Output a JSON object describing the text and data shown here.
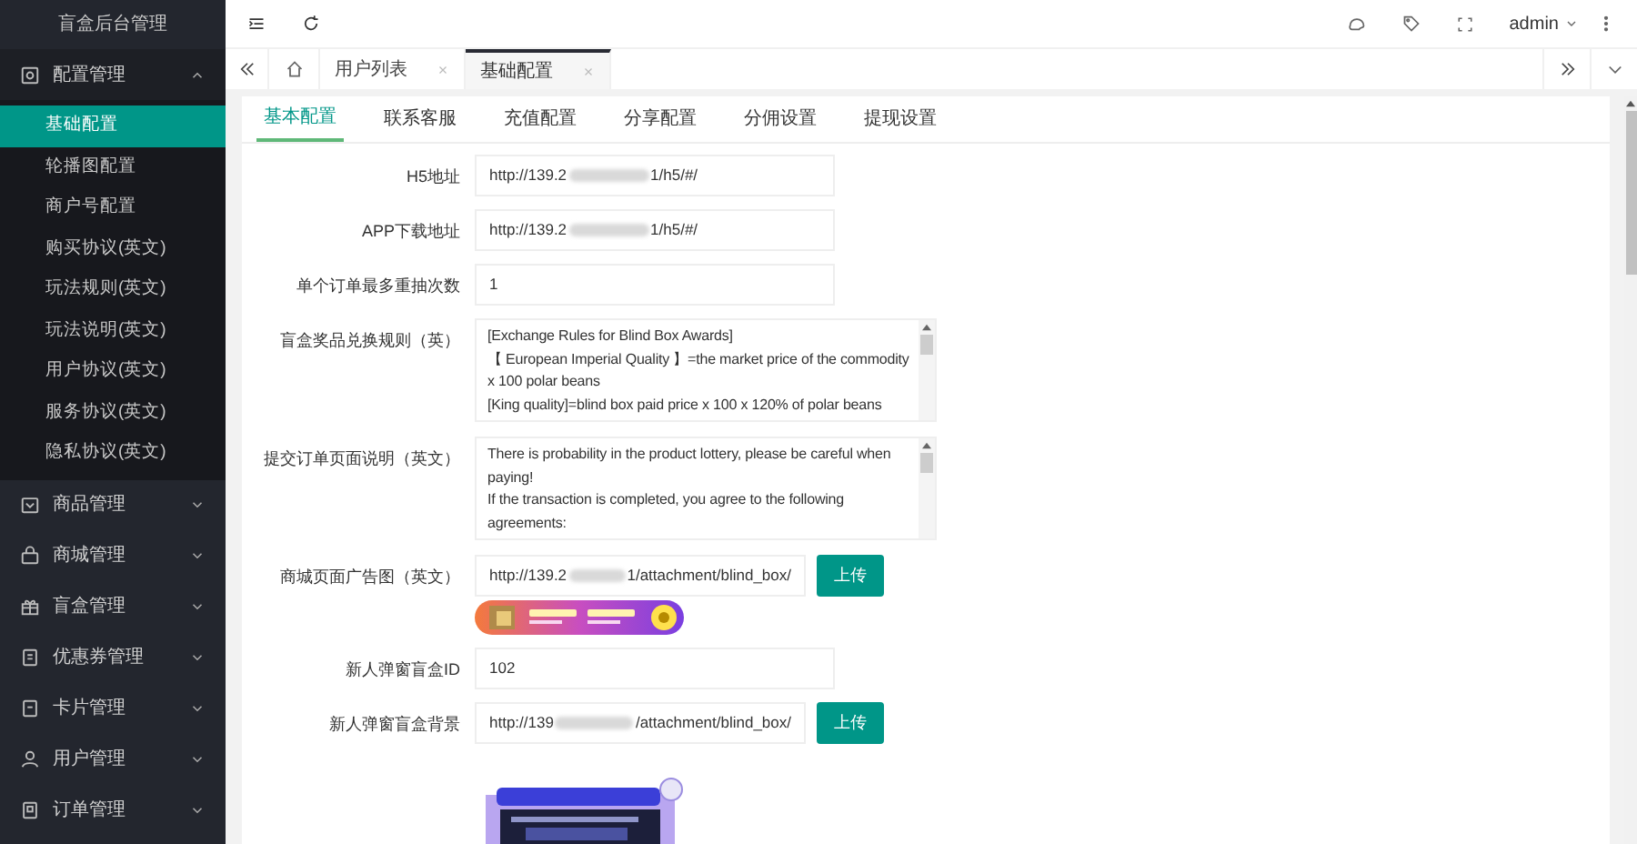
{
  "sidebar": {
    "title": "盲盒后台管理",
    "groups": [
      {
        "label": "配置管理",
        "expanded": true,
        "children": [
          {
            "label": "基础配置",
            "selected": true
          },
          {
            "label": "轮播图配置",
            "selected": false
          },
          {
            "label": "商户号配置",
            "selected": false
          },
          {
            "label": "购买协议(英文)",
            "selected": false
          },
          {
            "label": "玩法规则(英文)",
            "selected": false
          },
          {
            "label": "玩法说明(英文)",
            "selected": false
          },
          {
            "label": "用户协议(英文)",
            "selected": false
          },
          {
            "label": "服务协议(英文)",
            "selected": false
          },
          {
            "label": "隐私协议(英文)",
            "selected": false
          }
        ]
      },
      {
        "label": "商品管理",
        "expanded": false
      },
      {
        "label": "商城管理",
        "expanded": false
      },
      {
        "label": "盲盒管理",
        "expanded": false
      },
      {
        "label": "优惠券管理",
        "expanded": false
      },
      {
        "label": "卡片管理",
        "expanded": false
      },
      {
        "label": "用户管理",
        "expanded": false
      },
      {
        "label": "订单管理",
        "expanded": false
      }
    ]
  },
  "header": {
    "user": "admin"
  },
  "page_tabs": [
    {
      "label": "用户列表",
      "selected": false
    },
    {
      "label": "基础配置",
      "selected": true
    }
  ],
  "sub_tabs": [
    {
      "label": "基本配置",
      "selected": true
    },
    {
      "label": "联系客服",
      "selected": false
    },
    {
      "label": "充值配置",
      "selected": false
    },
    {
      "label": "分享配置",
      "selected": false
    },
    {
      "label": "分佣设置",
      "selected": false
    },
    {
      "label": "提现设置",
      "selected": false
    }
  ],
  "form": [
    {
      "kind": "input",
      "label": "H5地址",
      "value": "http://139.2",
      "value_after_blur": "1/h5/#/"
    },
    {
      "kind": "input",
      "label": "APP下载地址",
      "value": "http://139.2",
      "value_after_blur": "1/h5/#/"
    },
    {
      "kind": "input",
      "label": "单个订单最多重抽次数",
      "value": "1"
    },
    {
      "kind": "textarea",
      "label": "盲盒奖品兑换规则（英）",
      "lines": [
        "[Exchange Rules for Blind Box Awards]",
        "【 European Imperial Quality 】=the market price of the commodity x 100 polar beans",
        "[King quality]=blind box paid price x 100 x 120% of polar beans"
      ]
    },
    {
      "kind": "textarea",
      "label": "提交订单页面说明（英文）",
      "lines": [
        "There is probability in the product lottery, please be careful when paying!",
        "If the transaction is completed, you agree to the following agreements:"
      ]
    },
    {
      "kind": "upload",
      "label": "商城页面广告图（英文）",
      "value": "http://139.2",
      "value_after_blur": "1/attachment/blind_box/",
      "button": "上传"
    },
    {
      "kind": "input",
      "label": "新人弹窗盲盒ID",
      "value": "102"
    },
    {
      "kind": "upload",
      "label": "新人弹窗盲盒背景",
      "value": "http://139",
      "value_after_blur": "/attachment/blind_box/",
      "button": "上传"
    }
  ]
}
